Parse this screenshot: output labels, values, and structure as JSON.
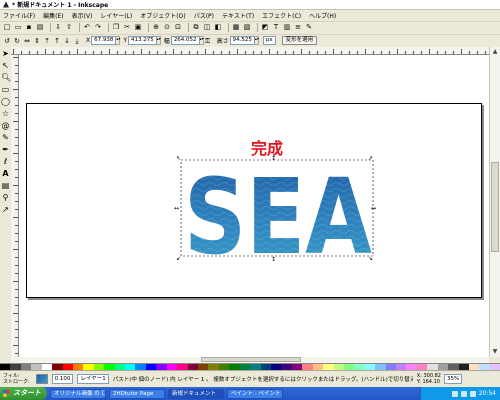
{
  "window": {
    "title": "* 新規ドキュメント 1 - Inkscape"
  },
  "menu": [
    "ファイル(F)",
    "編集(E)",
    "表示(V)",
    "レイヤー(L)",
    "オブジェクト(O)",
    "パス(P)",
    "テキスト(T)",
    "エフェクト(C)",
    "ヘルプ(H)"
  ],
  "controls": {
    "x_label": "X",
    "x_value": "67.938",
    "y_label": "Y",
    "y_value": "413.275",
    "w_label": "幅",
    "w_value": "264.052",
    "h_label": "高さ",
    "h_value": "94.525",
    "unit": "px",
    "apply_label": "変形を適用"
  },
  "canvas": {
    "caption": "完成",
    "artwork_text": "SEA"
  },
  "statusbar": {
    "fill_label": "フィル:",
    "stroke_label": "ストローク:",
    "opacity": "0.100",
    "layer": "レイヤー1",
    "message": "パスト(中 個のノード) 内 レイヤー 1 。 複数オブジェクトを選択するにはクリックまたはドラッグ。(ハンドル)で切り替え",
    "x_coord": "X: 300.82",
    "y_coord": "Y: 164.10",
    "zoom": "35%"
  },
  "taskbar": {
    "start": "スタート",
    "tasks": [
      "オリジナル画像 の 口",
      "2HDtutor Page",
      "新規ドキュメント",
      "ペイント - ペイント"
    ],
    "active_task": 2,
    "clock": "20:54"
  },
  "colors": {
    "caption": "#e0141e",
    "sea_top": "#1f5fa5",
    "sea_bottom": "#3aa0c8",
    "selection": "#000000"
  },
  "icons": [
    "selector-icon",
    "node-icon",
    "zoom-icon",
    "rect-icon",
    "ellipse-icon",
    "star-icon",
    "spiral-icon",
    "pencil-icon",
    "pen-icon",
    "calligraphy-icon",
    "text-icon",
    "gradient-icon",
    "dropper-icon",
    "connector-icon"
  ]
}
